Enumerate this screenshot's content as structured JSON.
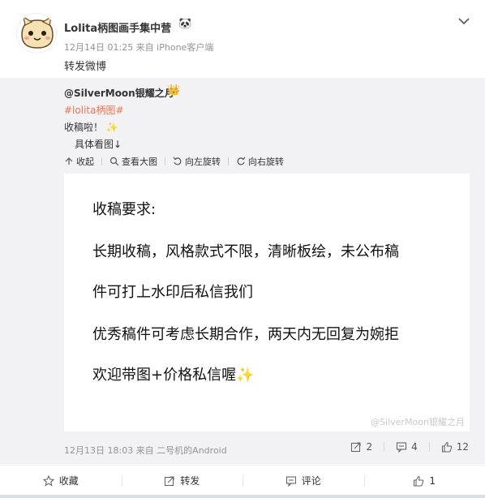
{
  "user": {
    "name": "Lolita柄图画手集中营",
    "badge": "🐼",
    "meta": "12月14日 01:25 来自 iPhone客户端",
    "text": "转发微博"
  },
  "repost": {
    "author": "@SilverMoon银耀之月",
    "author_badge": "👑",
    "tag": "#lolita柄图#",
    "line1": "收稿啦！",
    "line1_emoji": "✨",
    "line2": "具体看图↓",
    "toolbar": {
      "collapse": "收起",
      "view_large": "查看大图",
      "rotate_left": "向左旋转",
      "rotate_right": "向右旋转"
    },
    "image": {
      "lines": [
        "收稿要求:",
        "长期收稿，风格款式不限，清晰板绘，未公布稿",
        "件可打上水印后私信我们",
        "优秀稿件可考虑长期合作，两天内无回复为婉拒",
        "欢迎带图+价格私信喔✨"
      ],
      "watermark": "@SilverMoon银耀之月"
    },
    "footer": "12月13日 18:03 来自 二号机的Android",
    "stats": {
      "forward": "2",
      "comment": "4",
      "like": "12"
    }
  },
  "actions": {
    "favorite": "收藏",
    "forward": "转发",
    "comment": "评论",
    "like": "1"
  }
}
